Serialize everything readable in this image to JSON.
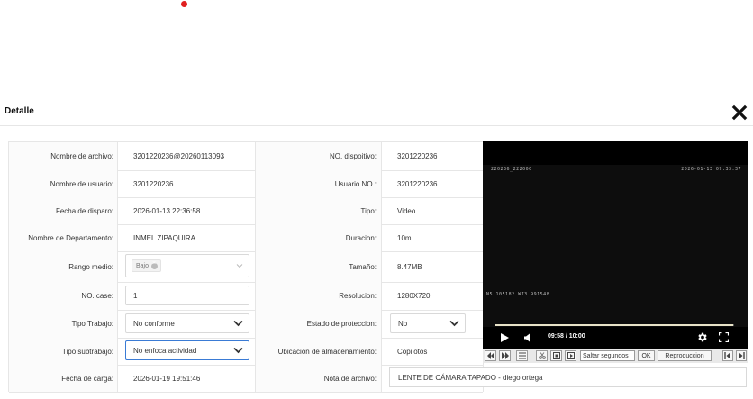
{
  "modal": {
    "title": "Detalle"
  },
  "fields": {
    "nombre_archivo": {
      "label": "Nombre de archivo:",
      "value": "3201220236@20260113093̶"
    },
    "no_dispositivo": {
      "label": "NO. dispoitivo:",
      "value": "3201220236"
    },
    "nombre_usuario": {
      "label": "Nombre de usuario:",
      "value": "3201220236"
    },
    "usuario_no": {
      "label": "Usuario NO.:",
      "value": "3201220236"
    },
    "fecha_disparo": {
      "label": "Fecha de disparo:",
      "value": "2026-01-13 22:36:58"
    },
    "tipo": {
      "label": "Tipo:",
      "value": "Video"
    },
    "departamento": {
      "label": "Nombre de Departamento:",
      "value": "INMEL ZIPAQUIRA"
    },
    "duracion": {
      "label": "Duracion:",
      "value": "10m"
    },
    "rango_medio": {
      "label": "Rango medio:",
      "tag": "Bajo"
    },
    "tamano": {
      "label": "Tamaño:",
      "value": "8.47MB"
    },
    "no_caso": {
      "label": "NO. case:",
      "value": "1"
    },
    "resolucion": {
      "label": "Resolucion:",
      "value": "1280X720"
    },
    "tipo_trabajo": {
      "label": "Tipo Trabajo:",
      "value": "No conforme"
    },
    "estado_proteccion": {
      "label": "Estado de proteccion:",
      "value": "No"
    },
    "tipo_subtrabajo": {
      "label": "Tipo subtrabajo:",
      "value": "No enfoca actividad"
    },
    "ubicacion": {
      "label": "Ubicacion de almacenamiento:",
      "value": "Copilotos"
    },
    "fecha_carga": {
      "label": "Fecha de carga:",
      "value": "2026-01-19 19:51:46"
    },
    "nota_archivo": {
      "label": "Nota de archivo:",
      "value": "LENTE DE CÁMARA TAPADO - diego ortega"
    }
  },
  "video": {
    "osd_top_left": "220236_222000",
    "osd_top_right": "2026-01-13 09:33:37",
    "osd_bottom_left": "N5.105182 W73.991548",
    "time": "09:58 / 10:00",
    "progress_fraction": 0.997
  },
  "toolbar": {
    "skip_placeholder": "Saltar segundos",
    "ok_label": "OK",
    "playback_label": "Reproduccion"
  },
  "colors": {
    "accent": "#3a7bd5",
    "close": "#111111",
    "marker": "#e02020"
  },
  "icons": [
    "close-icon",
    "chevron-down-icon",
    "play-icon",
    "volume-icon",
    "settings-icon",
    "fullscreen-icon",
    "rewind-icon",
    "fast-forward-icon",
    "list-icon",
    "scissors-icon",
    "frame-icon",
    "snapshot-icon",
    "skip-start-icon",
    "skip-end-icon"
  ]
}
